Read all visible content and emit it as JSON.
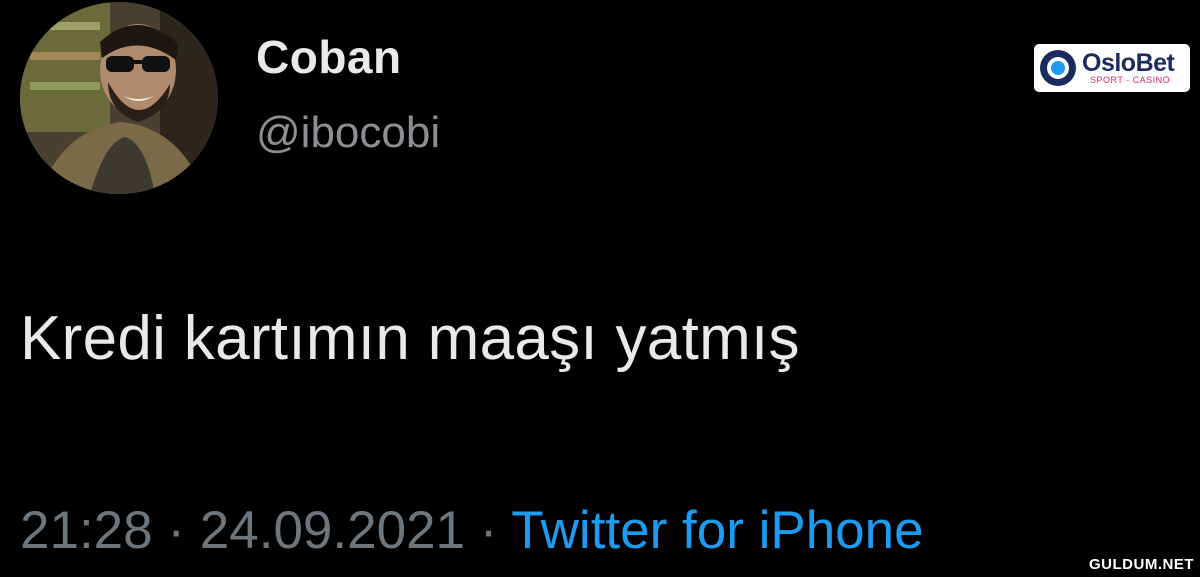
{
  "user": {
    "display_name": "Coban",
    "handle": "@ibocobi",
    "avatar": "profile-photo"
  },
  "tweet": {
    "text": "Kredi kartımın maaşı yatmış",
    "time": "21:28",
    "separator": "·",
    "date": "24.09.2021",
    "source": "Twitter for iPhone"
  },
  "overlays": {
    "logo_text": "OsloBet",
    "logo_sub": "SPORT - CASINO",
    "watermark": "GULDUM.NET"
  },
  "colors": {
    "background": "#000000",
    "text": "#e7e9ea",
    "muted": "#6e767d",
    "link": "#1d9bf0"
  }
}
